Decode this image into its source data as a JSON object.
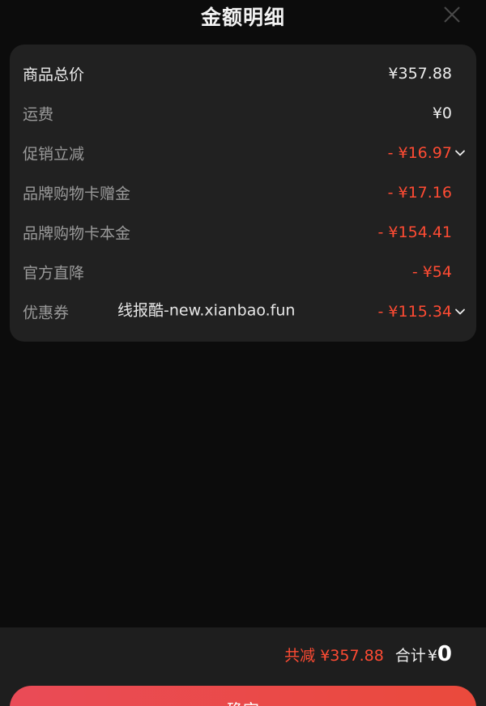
{
  "header": {
    "title": "金额明细"
  },
  "details": {
    "rows": [
      {
        "label": "商品总价",
        "value": "¥357.88"
      },
      {
        "label": "运费",
        "value": "¥0"
      },
      {
        "label": "促销立减",
        "value": "- ¥16.97"
      },
      {
        "label": "品牌购物卡赠金",
        "value": "- ¥17.16"
      },
      {
        "label": "品牌购物卡本金",
        "value": "- ¥154.41"
      },
      {
        "label": "官方直降",
        "value": "- ¥54"
      },
      {
        "label": "优惠券",
        "value": "- ¥115.34"
      }
    ],
    "watermark": "线报酷-new.xianbao.fun"
  },
  "footer": {
    "total_reduction": "共减 ¥357.88",
    "total_label": "合计",
    "total_currency": "¥",
    "total_amount": "0",
    "confirm_label": "确定"
  },
  "colors": {
    "background": "#0c0c0c",
    "card": "#212121",
    "discount": "#ff4b33",
    "button": "#ea4b4b"
  }
}
